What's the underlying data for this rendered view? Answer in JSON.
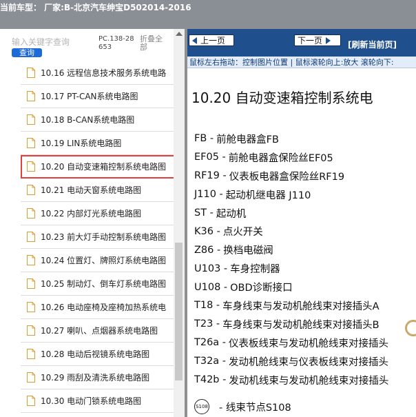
{
  "header": {
    "title": "当前车型： 厂家:B-北京汽车绅宝D502014-2016"
  },
  "sidebar": {
    "search_placeholder": "输入关键字查询",
    "search_button": "查询",
    "pc_code": "PC.138-28653",
    "collapse_all": "折叠全部",
    "items": [
      {
        "label": "10.16  远程信息技术服务系统电路",
        "selected": false
      },
      {
        "label": "10.17  PT-CAN系统电路图",
        "selected": false
      },
      {
        "label": "10.18  B-CAN系统电路图",
        "selected": false
      },
      {
        "label": "10.19  LIN系统电路图",
        "selected": false
      },
      {
        "label": "10.20  自动变速箱控制系统电路图",
        "selected": true
      },
      {
        "label": "10.21  电动天窗系统电路图",
        "selected": false
      },
      {
        "label": "10.22  内部灯光系统电路图",
        "selected": false
      },
      {
        "label": "10.23  前大灯手动控制系统电路图",
        "selected": false
      },
      {
        "label": "10.24  位置灯、牌照灯系统电路图",
        "selected": false
      },
      {
        "label": "10.25  制动灯、倒车灯系统电路图",
        "selected": false
      },
      {
        "label": "10.26  电动座椅及座椅加热系统电",
        "selected": false
      },
      {
        "label": "10.27  喇叭、点烟器系统电路图",
        "selected": false
      },
      {
        "label": "10.28  电动后视镜系统电路图",
        "selected": false
      },
      {
        "label": "10.29  雨刮及清洗系统电路图",
        "selected": false
      },
      {
        "label": "10.30  电动门锁系统电路图",
        "selected": false
      }
    ]
  },
  "viewer": {
    "prev_label": "上一页",
    "next_label": "下一页",
    "refresh_label": "[刷新当前页]",
    "hint": "鼠标左右拖动：控制图片位置 | 鼠标滚轮向上:放大  滚轮向下:",
    "doc_title": "10.20  自动变速箱控制系统电",
    "legend": [
      {
        "code": "FB -",
        "desc": "前舱电器盒FB"
      },
      {
        "code": "EF05 -",
        "desc": "前舱电器盒保险丝EF05"
      },
      {
        "code": "RF19 -",
        "desc": "仪表板电器盒保险丝RF19"
      },
      {
        "code": "J110 -",
        "desc": "起动机继电器 J110"
      },
      {
        "code": "ST -",
        "desc": "起动机"
      },
      {
        "code": "K36 -",
        "desc": "点火开关"
      },
      {
        "code": "Z86 -",
        "desc": "换档电磁阀"
      },
      {
        "code": "U103 -",
        "desc": "车身控制器"
      },
      {
        "code": "U108 -",
        "desc": "OBD诊断接口"
      },
      {
        "code": "T18 -",
        "desc": "车身线束与发动机舱线束对接插头A"
      },
      {
        "code": "T23 -",
        "desc": "车身线束与发动机舱线束对接插头B"
      },
      {
        "code": "T26a -",
        "desc": "仪表板线束与发动机舱线束对接插头"
      },
      {
        "code": "T32a -",
        "desc": "发动机舱线束与仪表板线束对接插头"
      },
      {
        "code": "T42b -",
        "desc": "发动机线束与发动机舱线束对接插头"
      }
    ],
    "node_symbol": "S108",
    "node_desc": "-  线束节点S108"
  },
  "colors": {
    "header_bg": "#8a8e95",
    "nav_bg": "#1f4f8c",
    "selected_outline": "#e43d3d",
    "search_button_bg": "#1c6bd8"
  }
}
